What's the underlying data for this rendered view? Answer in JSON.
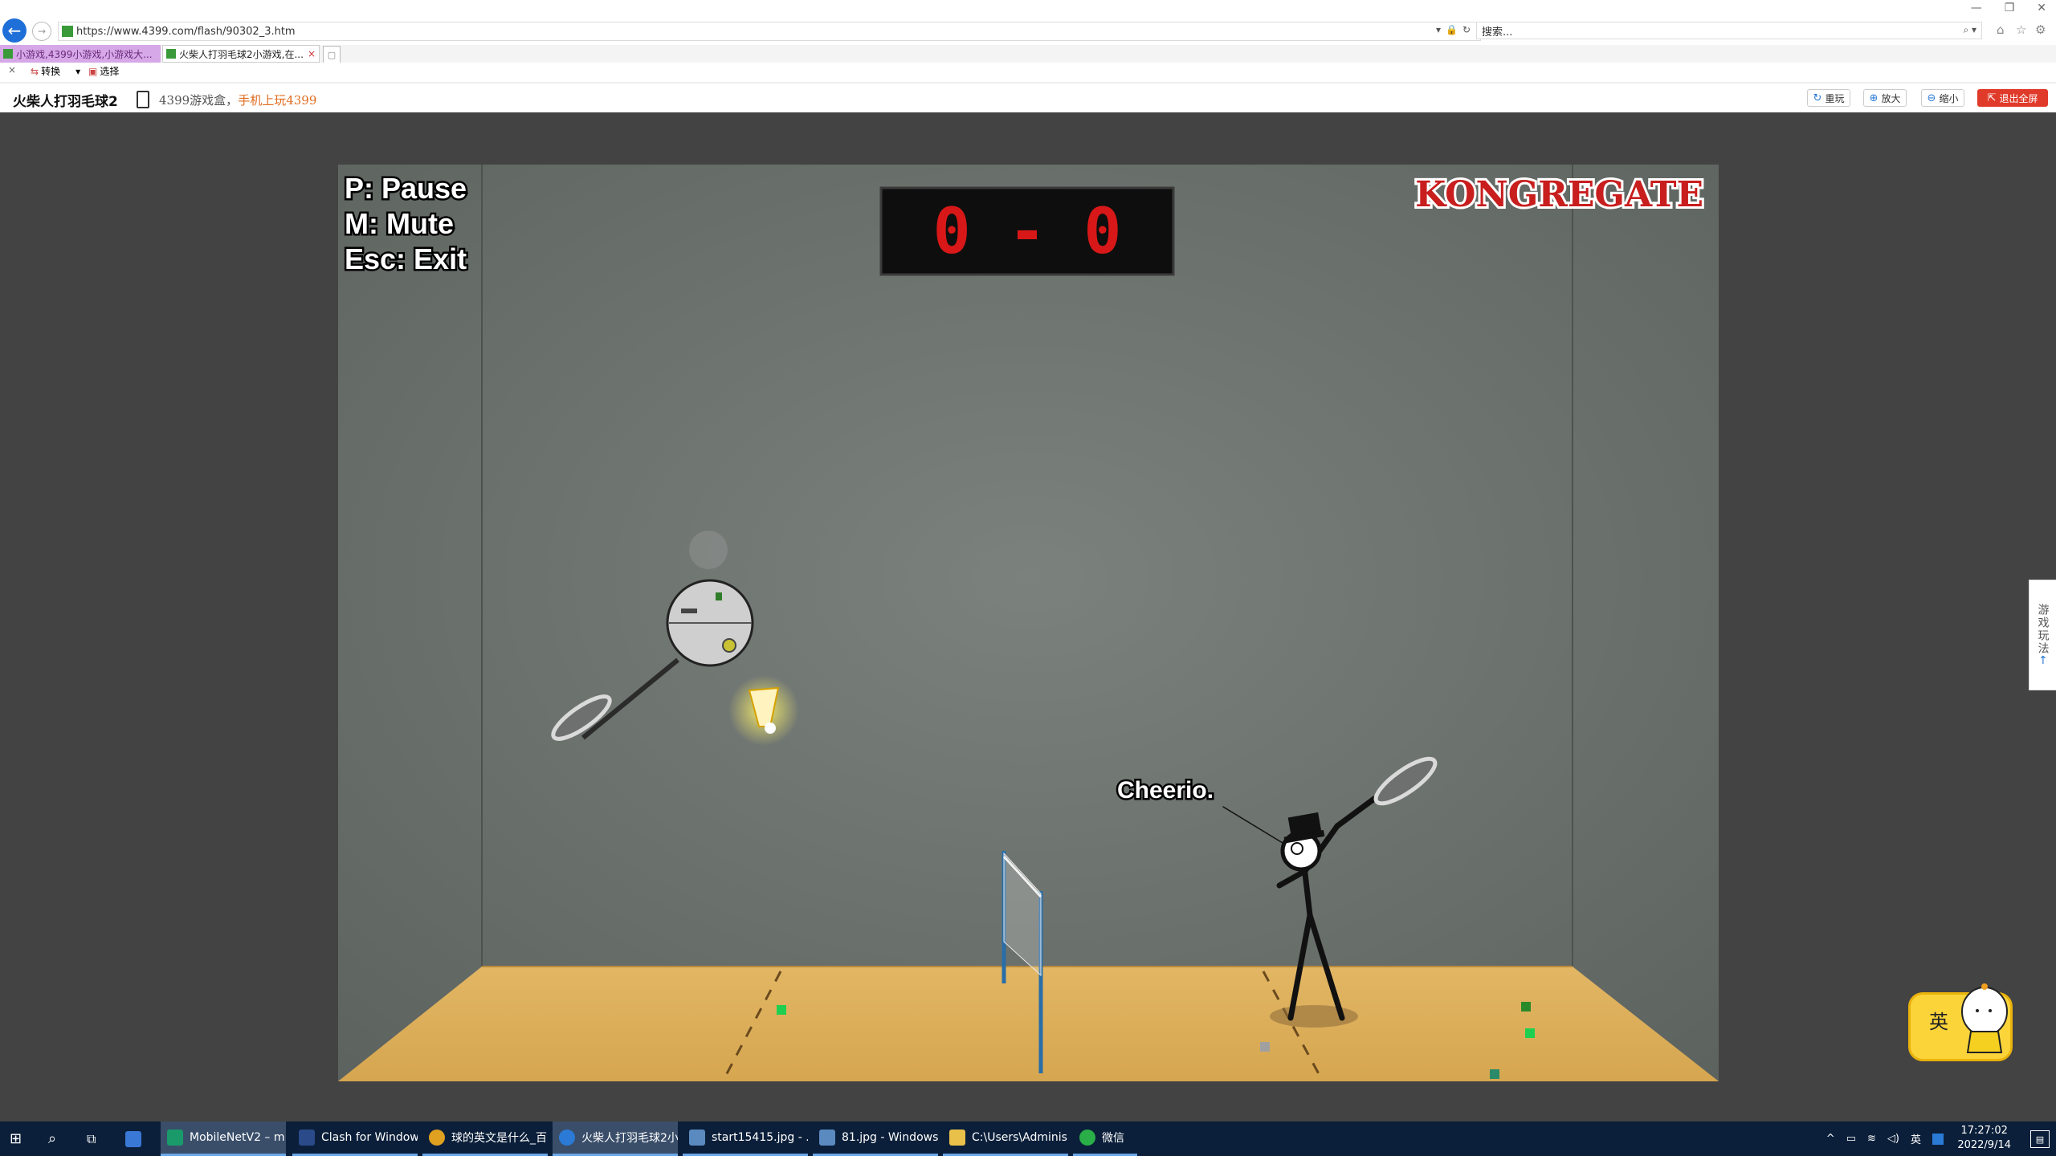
{
  "browser": {
    "url": "https://www.4399.com/flash/90302_3.htm",
    "search_placeholder": "搜索...",
    "tabs": [
      {
        "label": "小游戏,4399小游戏,小游戏大..."
      },
      {
        "label": "火柴人打羽毛球2小游戏,在...",
        "close": "×"
      }
    ],
    "toolbar": {
      "close": "×",
      "convert": "转换",
      "select": "选择"
    }
  },
  "site": {
    "game_title": "火柴人打羽毛球2",
    "promo_text": "4399游戏盒，",
    "promo_highlight": "手机上玩4399",
    "buttons": {
      "replay": "重玩",
      "zoom_in": "放大",
      "zoom_out": "缩小",
      "exit_fullscreen": "退出全屏"
    },
    "side_tab": "游戏玩法"
  },
  "game": {
    "controls": [
      "P: Pause",
      "M: Mute",
      "Esc: Exit"
    ],
    "score": "0 - 0",
    "brand": "KONGREGATE",
    "speech": "Cheerio."
  },
  "ime": {
    "label": "英"
  },
  "taskbar": {
    "apps": [
      {
        "label": "MobileNetV2 – m...",
        "color": "#1a9a6a"
      },
      {
        "label": "Clash for Windows",
        "color": "#2a4a8a"
      },
      {
        "label": "球的英文是什么_百...",
        "color": "#e0a020"
      },
      {
        "label": "火柴人打羽毛球2小...",
        "color": "#2a7ad6"
      },
      {
        "label": "start15415.jpg - ...",
        "color": "#5a8ac0"
      },
      {
        "label": "81.jpg - Windows...",
        "color": "#5a8ac0"
      },
      {
        "label": "C:\\Users\\Adminis...",
        "color": "#e8c04a"
      },
      {
        "label": "微信",
        "color": "#2aae48"
      }
    ],
    "tray_lang": "英",
    "time": "17:27:02",
    "date": "2022/9/14"
  }
}
